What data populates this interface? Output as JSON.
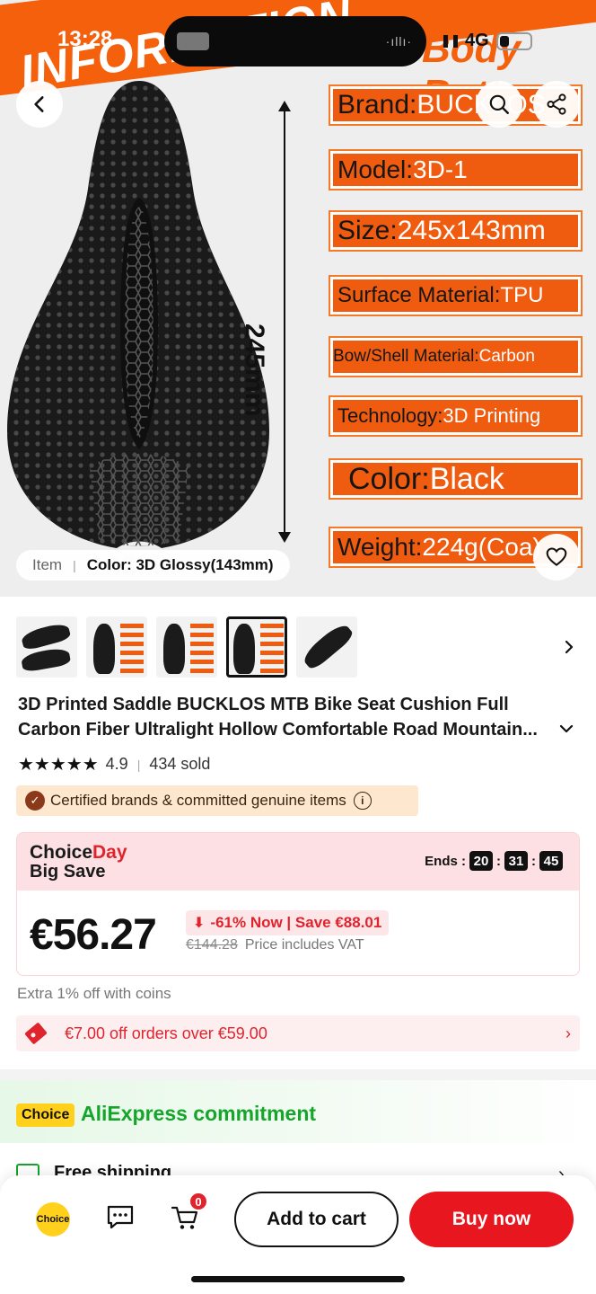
{
  "status_bar": {
    "time": "13:28",
    "network": "4G"
  },
  "hero": {
    "banner_left": "INFORMATION",
    "banner_right": "Body Bottom",
    "dimension_vertical": "245mm",
    "dimension_bottom": "143mm",
    "specs": [
      {
        "key": "Brand:",
        "value": "BUCKLOS"
      },
      {
        "key": "Model:",
        "value": "3D-1"
      },
      {
        "key": "Size:",
        "value": "245x143mm"
      },
      {
        "key": "Surface Material:",
        "value": "TPU"
      },
      {
        "key": "Bow/Shell Material:",
        "value": "Carbon"
      },
      {
        "key": "Technology:",
        "value": "3D Printing"
      },
      {
        "key": "Color: ",
        "value": "Black"
      },
      {
        "key": "Weight:",
        "value": "224g(Coa)"
      }
    ],
    "item_label": "Item",
    "item_value": "Color: 3D Glossy(143mm)"
  },
  "product": {
    "title_line1": "3D Printed Saddle BUCKLOS MTB Bike Seat Cushion Full",
    "title_line2": "Carbon Fiber Ultralight Hollow Comfortable Road Mountain...",
    "stars": "★★★★★",
    "rating": "4.9",
    "sold": "434 sold",
    "certified": "Certified brands & committed genuine items"
  },
  "choice_day": {
    "logo_a": "Choice",
    "logo_b": "Day",
    "logo_line2": "Big Save",
    "ends_label": "Ends :",
    "hours": "20",
    "minutes": "31",
    "seconds": "45",
    "price": "€56.27",
    "discount": "-61% Now | Save €88.01",
    "original_price": "€144.28",
    "vat_note": "Price includes VAT"
  },
  "coins_note": "Extra 1% off with coins",
  "coupon": "€7.00 off orders over €59.00",
  "commitment": {
    "tag": "Choice",
    "title": "AliExpress commitment",
    "shipping": "Free shipping"
  },
  "bottom_bar": {
    "choice_label": "Choice",
    "cart_count": "0",
    "add_to_cart": "Add to cart",
    "buy_now": "Buy now"
  },
  "colors": {
    "accent_red": "#e8161e",
    "brand_orange": "#ef5c10",
    "choice_yellow": "#ffd11c",
    "commit_green": "#15a52b"
  }
}
